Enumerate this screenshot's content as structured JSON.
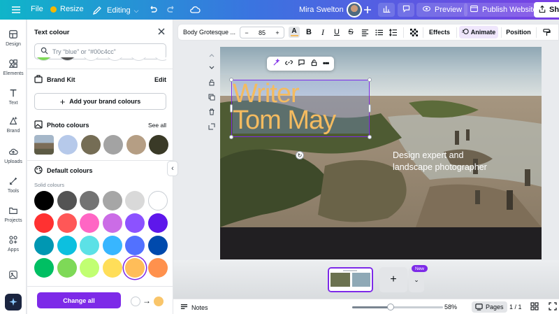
{
  "topbar": {
    "file_label": "File",
    "resize_label": "Resize",
    "editing_label": "Editing",
    "user_name": "Mira Swelton",
    "preview_label": "Preview",
    "publish_label": "Publish Website",
    "share_label": "Sh"
  },
  "rail": {
    "items": [
      {
        "label": "Design",
        "icon": "design-icon"
      },
      {
        "label": "Elements",
        "icon": "elements-icon"
      },
      {
        "label": "Text",
        "icon": "text-icon"
      },
      {
        "label": "Brand",
        "icon": "brand-icon"
      },
      {
        "label": "Uploads",
        "icon": "uploads-icon"
      },
      {
        "label": "Tools",
        "icon": "tools-icon"
      },
      {
        "label": "Projects",
        "icon": "projects-icon"
      },
      {
        "label": "Apps",
        "icon": "apps-icon"
      }
    ]
  },
  "panel": {
    "title": "Text colour",
    "search_placeholder": "Try “blue” or “#00c4cc”",
    "brand_kit_label": "Brand Kit",
    "edit_label": "Edit",
    "add_brand_label": "Add your brand colours",
    "photo_colours_label": "Photo colours",
    "see_all_label": "See all",
    "photo_colours": [
      "#b6c9ea",
      "#756d55",
      "#a3a3a3",
      "#b59e84",
      "#3a3a27"
    ],
    "default_colours_label": "Default colours",
    "solid_colours_label": "Solid colours",
    "solid_colours": [
      [
        "#000000",
        "#545454",
        "#737373",
        "#a6a6a6",
        "#d9d9d9",
        "#ffffff"
      ],
      [
        "#ff3131",
        "#ff5757",
        "#ff66c4",
        "#cb6ce6",
        "#8c52ff",
        "#5e17eb"
      ],
      [
        "#0097b2",
        "#0cc0df",
        "#5ce1e6",
        "#38b6ff",
        "#5271ff",
        "#004aad"
      ],
      [
        "#00bf63",
        "#7ed957",
        "#c1ff72",
        "#ffde59",
        "#ffbd59",
        "#ff914d"
      ]
    ],
    "change_all_label": "Change all",
    "to_colour": "#f9c56a"
  },
  "toolbar": {
    "font_name": "Body Grotesque ...",
    "font_size": "85",
    "effects_label": "Effects",
    "animate_label": "Animate",
    "position_label": "Position"
  },
  "canvas": {
    "title_line1": "Writer",
    "title_line2": "Tom May",
    "subtitle_line1": "Design expert and",
    "subtitle_line2": "landscape photographer",
    "title_colour": "#f4bb60"
  },
  "pages": {
    "new_badge": "New"
  },
  "statusbar": {
    "notes_label": "Notes",
    "zoom_value": 58,
    "zoom_label": "58%",
    "pages_label": "Pages",
    "page_count": "1 / 1"
  },
  "colors": {
    "accent": "#7d2ae8",
    "topbar_start": "#0fb5c9",
    "topbar_end": "#7a3fe4"
  }
}
